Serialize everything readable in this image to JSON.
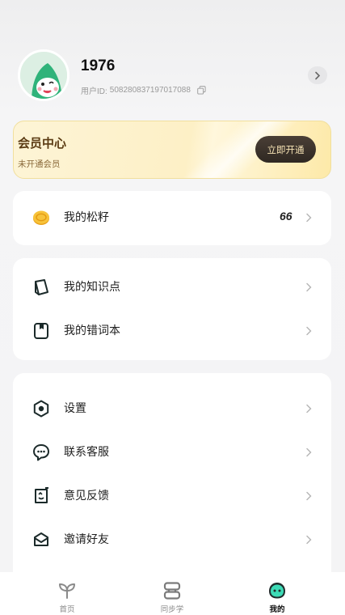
{
  "profile": {
    "username": "1976",
    "user_id_label": "用户ID:",
    "user_id": "508280837197017088"
  },
  "vip": {
    "title": "会员中心",
    "subtitle": "未开通会员",
    "button_label": "立即开通"
  },
  "coins": {
    "label": "我的松籽",
    "count": "66"
  },
  "study": {
    "items": [
      {
        "label": "我的知识点",
        "icon": "book-icon"
      },
      {
        "label": "我的错词本",
        "icon": "notebook-icon"
      }
    ]
  },
  "more": {
    "items": [
      {
        "label": "设置",
        "icon": "settings-icon"
      },
      {
        "label": "联系客服",
        "icon": "chat-icon"
      },
      {
        "label": "意见反馈",
        "icon": "feedback-icon"
      },
      {
        "label": "邀请好友",
        "icon": "invite-icon"
      }
    ]
  },
  "tabbar": {
    "tabs": [
      {
        "label": "首页",
        "icon": "sprout-icon",
        "active": false
      },
      {
        "label": "同步学",
        "icon": "stack-icon",
        "active": false
      },
      {
        "label": "我的",
        "icon": "mascot-icon",
        "active": true
      }
    ]
  },
  "colors": {
    "accent": "#2fb37a",
    "vip_text": "#5a3a12",
    "vip_button": "#3a322b"
  }
}
